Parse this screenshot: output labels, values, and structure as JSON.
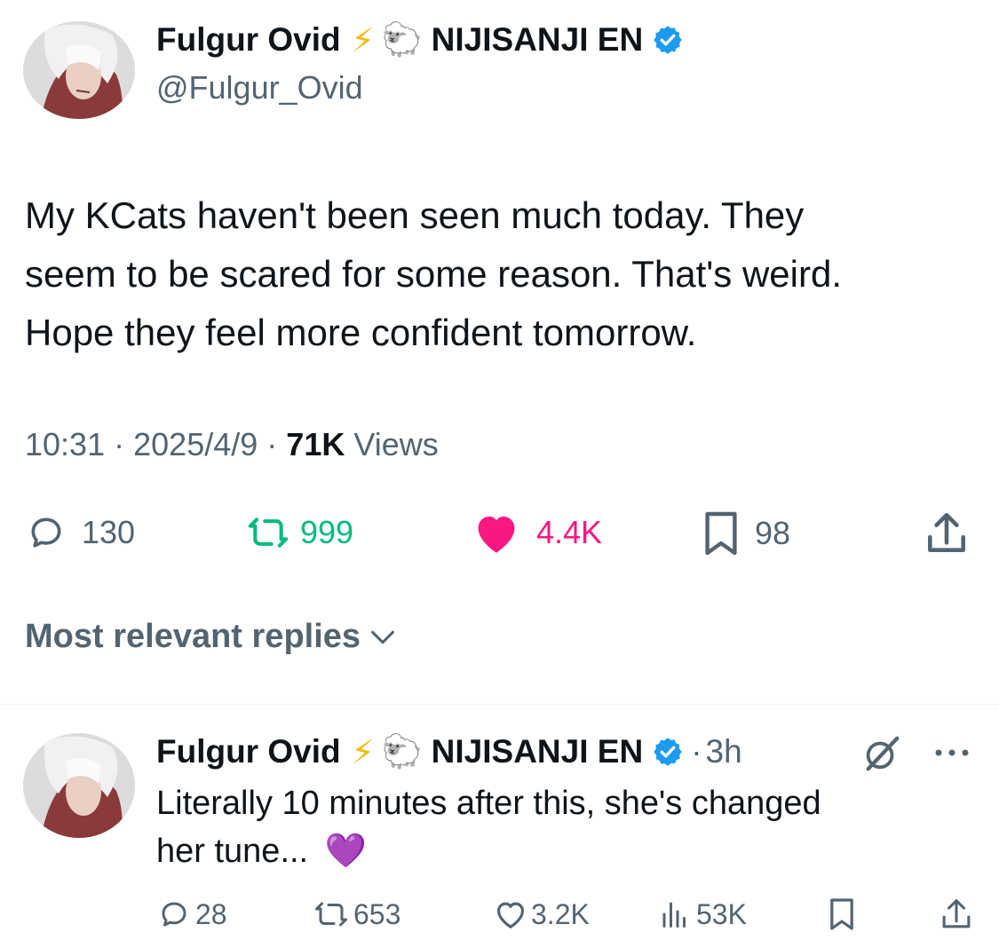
{
  "colors": {
    "text": "#0f1419",
    "muted": "#536471",
    "verified": "#1d9bf0",
    "lightning": "#f5b800",
    "retweet": "#00ba7c",
    "like": "#f91880",
    "heart_purple": "#9b51e0"
  },
  "main_tweet": {
    "author_name": "Fulgur Ovid",
    "lightning_emoji": "⚡",
    "sheep_emoji": "🐑",
    "affiliation": "NIJISANJI EN",
    "handle": "@Fulgur_Ovid",
    "text_lines": [
      "My KCats haven't been seen much today. They",
      "seem to be scared for some reason. That's weird.",
      "Hope they feel more confident tomorrow."
    ],
    "time": "10:31",
    "dot": "·",
    "date": "2025/4/9",
    "views_count": "71K",
    "views_label": "Views",
    "stats": {
      "replies": "130",
      "retweets": "999",
      "likes": "4.4K",
      "bookmarks": "98"
    },
    "icons": [
      "reply-icon",
      "retweet-icon",
      "like-icon-filled",
      "bookmark-icon",
      "share-icon"
    ]
  },
  "replies_sort": {
    "label": "Most relevant replies",
    "icon": "chevron-down-icon"
  },
  "reply": {
    "author_name": "Fulgur Ovid",
    "lightning_emoji": "⚡",
    "sheep_emoji": "🐑",
    "affiliation": "NIJISANJI EN",
    "dot": "·",
    "time_ago": "3h",
    "text_lines": [
      "Literally 10 minutes after this, she's changed",
      "her tune..."
    ],
    "heart_emoji": "💜",
    "stats": {
      "replies": "28",
      "retweets": "653",
      "likes": "3.2K",
      "views": "53K"
    },
    "icons": [
      "grok-icon",
      "more-icon",
      "reply-icon",
      "retweet-icon",
      "like-icon",
      "views-icon",
      "bookmark-icon",
      "share-icon"
    ]
  }
}
